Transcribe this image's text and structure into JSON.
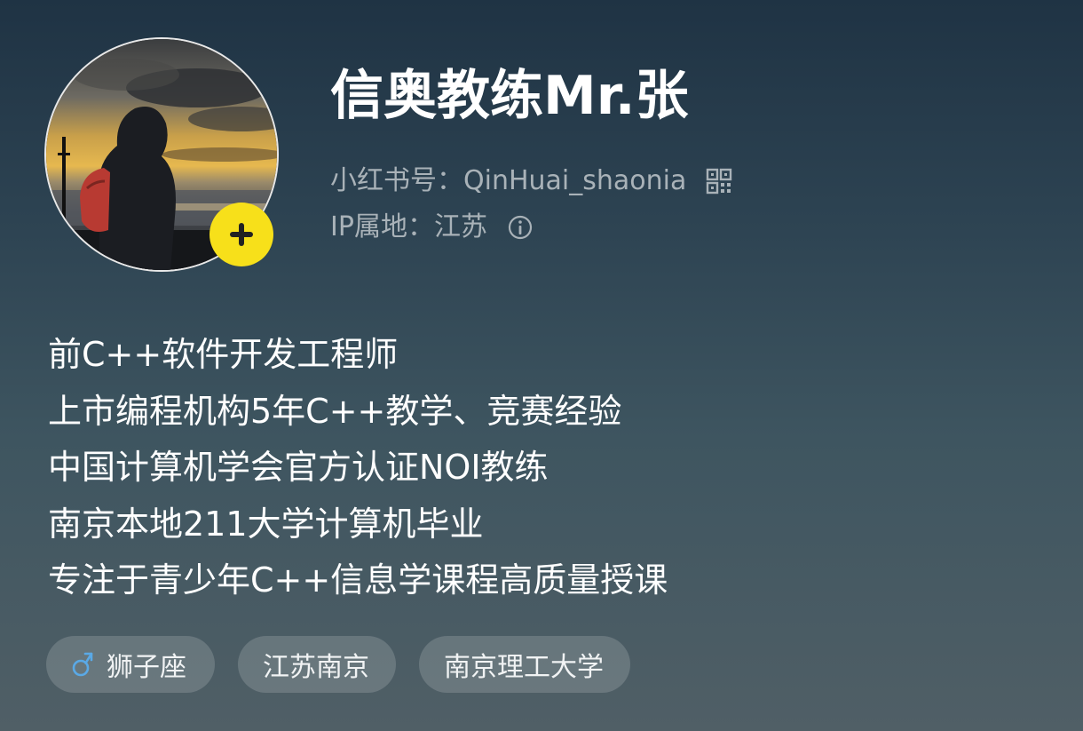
{
  "profile": {
    "name": "信奥教练Mr.张",
    "redbook_id_label": "小红书号：QinHuai_shaonia",
    "ip_label": "IP属地：江苏",
    "follow_icon": "plus-icon",
    "follow_badge_color": "#f7e01a"
  },
  "bio": {
    "lines": [
      "前C++软件开发工程师",
      "上市编程机构5年C++教学、竞赛经验",
      "中国计算机学会官方认证NOI教练",
      "南京本地211大学计算机毕业",
      "专注于青少年C++信息学课程高质量授课"
    ]
  },
  "tags": [
    {
      "label": "狮子座",
      "icon": "male-icon",
      "icon_color": "#5aa9e6"
    },
    {
      "label": "江苏南京"
    },
    {
      "label": "南京理工大学"
    }
  ]
}
